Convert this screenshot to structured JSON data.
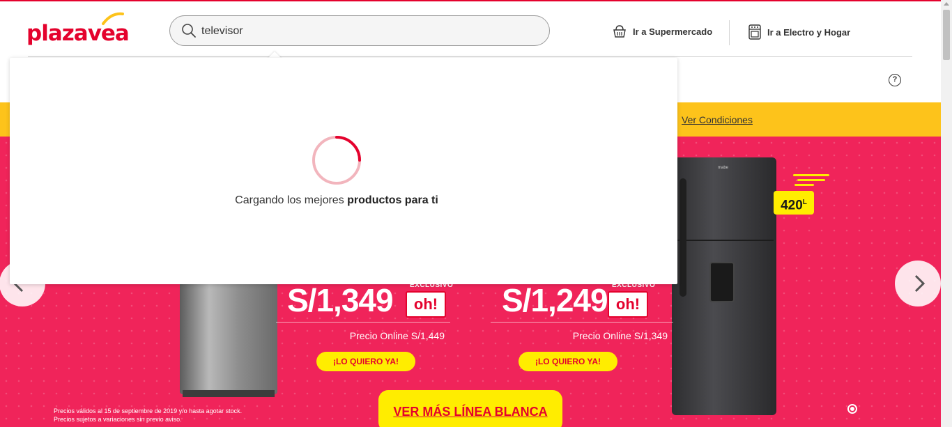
{
  "header": {
    "logo_text": "plazavea",
    "search": {
      "value": "televisor",
      "placeholder": ""
    },
    "links": [
      {
        "label": "Ir a Supermercado",
        "icon": "basket-icon"
      },
      {
        "label": "Ir a Electro y Hogar",
        "icon": "stove-icon"
      }
    ],
    "help_label": "?"
  },
  "promo_bar": {
    "conditions_link": "Ver Condiciones"
  },
  "search_dropdown": {
    "loading_text_plain": "Cargando los mejores ",
    "loading_text_bold": "productos para ti"
  },
  "banner": {
    "offers": [
      {
        "price": "S/1,349",
        "exclusive_label": "EXCLUSIVO",
        "badge": "oh!",
        "online_price": "Precio Online S/1,449",
        "cta": "¡LO QUIERO YA!"
      },
      {
        "price": "S/1,249",
        "exclusive_label": "EXCLUSIVO",
        "badge": "oh!",
        "online_price": "Precio Online S/1,349",
        "cta": "¡LO QUIERO YA!"
      }
    ],
    "capacity": "420",
    "capacity_unit": "L",
    "fridge_brand": "mabe",
    "more_button": "VER MÁS LÍNEA BLANCA",
    "legal_line1": "Precios válidos al 15 de septiembre de 2019 y/o hasta agotar stock.",
    "legal_line2": "Precios sujetos a variaciones sin previo aviso.",
    "colors": {
      "banner": "#f0245a",
      "accent_yellow": "#ffed00",
      "brand_red": "#e4022d",
      "promo_yellow": "#fdc31b"
    }
  }
}
